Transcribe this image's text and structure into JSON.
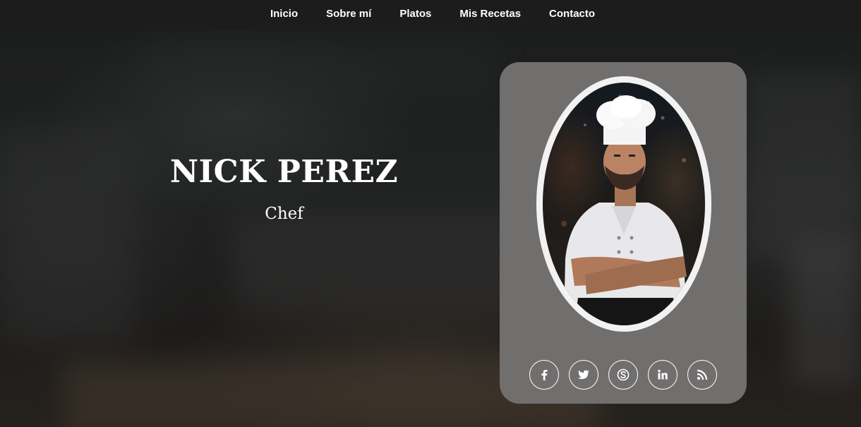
{
  "nav": {
    "items": [
      {
        "label": "Inicio"
      },
      {
        "label": "Sobre mí"
      },
      {
        "label": "Platos"
      },
      {
        "label": "Mis Recetas"
      },
      {
        "label": "Contacto"
      }
    ]
  },
  "hero": {
    "name": "NICK PEREZ",
    "role": "Chef"
  },
  "profile_card": {
    "portrait": "chef-portrait",
    "socials": [
      {
        "icon": "facebook-icon"
      },
      {
        "icon": "twitter-icon"
      },
      {
        "icon": "skype-icon"
      },
      {
        "icon": "linkedin-icon"
      },
      {
        "icon": "rss-icon"
      }
    ]
  },
  "colors": {
    "navbar": "#1c1c1c",
    "card": "#716e6e",
    "text": "#ffffff"
  }
}
